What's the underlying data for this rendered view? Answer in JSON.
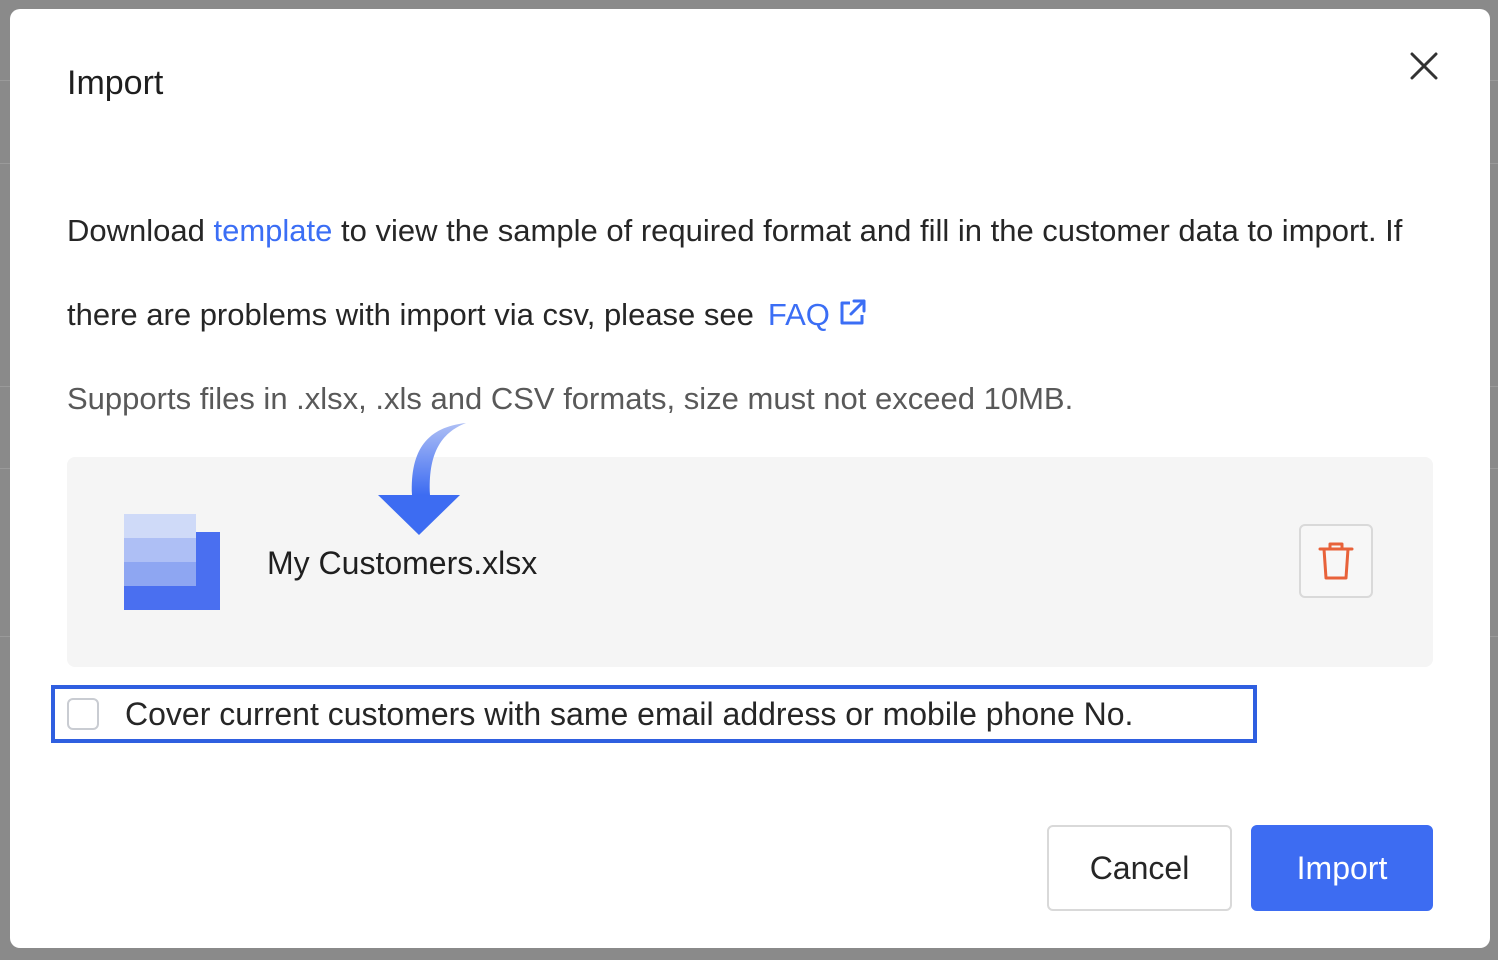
{
  "dialog": {
    "title": "Import",
    "close_icon": "close-icon"
  },
  "description": {
    "prefix": "Download ",
    "template_link": "template",
    "middle": " to view the sample of required format and fill in the customer data to import. If there are problems with import via csv, please see",
    "faq_link": "FAQ",
    "faq_icon": "external-link-icon"
  },
  "supports_text": "Supports files in .xlsx, .xls and CSV formats, size must not exceed 10MB.",
  "uploaded_file": {
    "name": "My Customers.xlsx",
    "icon": "spreadsheet-file-icon",
    "delete_icon": "trash-icon"
  },
  "cover_option": {
    "label": "Cover current customers with same email address or mobile phone No.",
    "checked": false
  },
  "footer": {
    "cancel_label": "Cancel",
    "import_label": "Import"
  },
  "colors": {
    "accent": "#3d6cf2",
    "link": "#3b6ef5",
    "delete": "#e8623a",
    "highlight": "#2f5fe0"
  }
}
